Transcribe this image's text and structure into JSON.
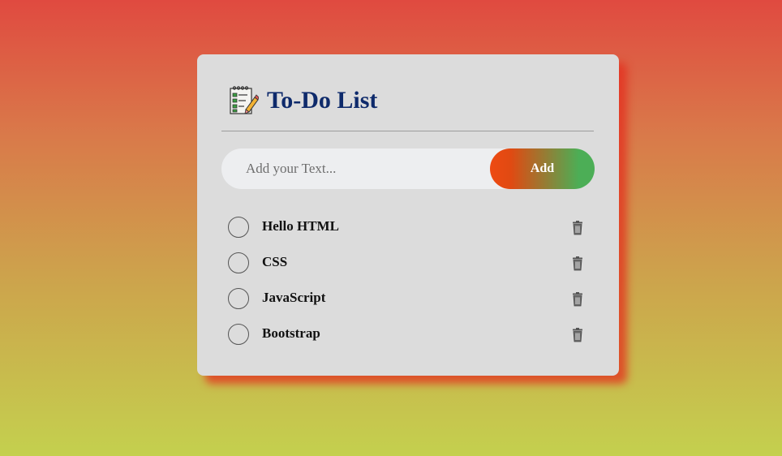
{
  "app": {
    "title": "To-Do List",
    "icon": "notepad-icon"
  },
  "input": {
    "placeholder": "Add your Text...",
    "value": ""
  },
  "add_button": {
    "label": "Add"
  },
  "tasks": [
    {
      "label": "Hello HTML",
      "done": false
    },
    {
      "label": "CSS",
      "done": false
    },
    {
      "label": "JavaScript",
      "done": false
    },
    {
      "label": "Bootstrap",
      "done": false
    }
  ],
  "colors": {
    "title": "#0e2a6b",
    "card": "#dcdcdc",
    "add_gradient_start": "#ee4a12",
    "add_gradient_end": "#4cae56"
  }
}
